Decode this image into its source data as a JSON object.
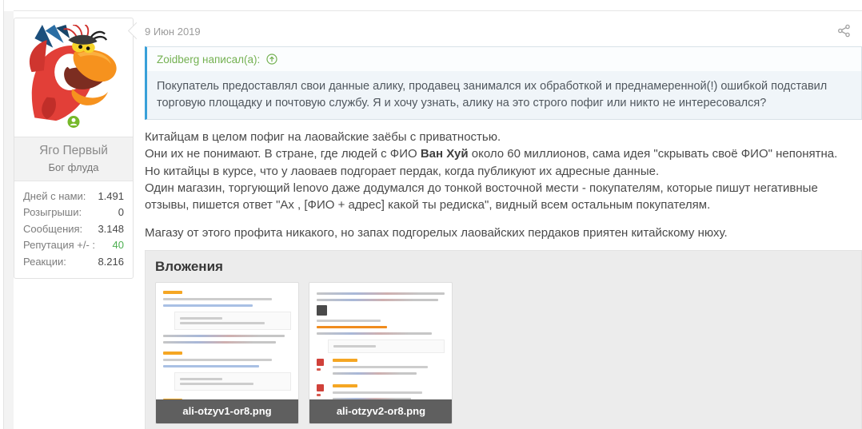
{
  "post": {
    "date": "9 Июн 2019"
  },
  "user": {
    "name": "Яго Первый",
    "title": "Бог флуда",
    "online": true,
    "stats": [
      {
        "label": "Дней с нами:",
        "value": "1.491"
      },
      {
        "label": "Розыгрыши:",
        "value": "0"
      },
      {
        "label": "Сообщения:",
        "value": "3.148"
      },
      {
        "label": "Репутация +/- :",
        "value": "40"
      },
      {
        "label": "Реакции:",
        "value": "8.216"
      }
    ]
  },
  "quote": {
    "attribution": "Zoidberg написал(а):",
    "text": "Покупатель предоставлял свои данные алику, продавец занимался их обработкой и преднамеренной(!) ошибкой подставил торговую площадку и почтовую службу. Я и хочу узнать, алику на это строго пофиг или никто не интересовался?"
  },
  "body": {
    "line1": "Китайцам в целом пофиг на лаовайские заёбы с приватностью.",
    "line2_pre": "Они их не понимают. В стране, где людей с ФИО ",
    "line2_bold": "Ван Хуй",
    "line2_post": " около 60 миллионов, сама идея \"скрывать своё ФИО\" непонятна.",
    "line3": "Но китайцы в курсе, что у лаоваев подгорает пердак, когда публикуют их адресные данные.",
    "line4": "Один магазин, торгующий lenovo даже додумался до тонкой восточной мести - покупателям, которые пишут негативные отзывы, пишется ответ \"Ах , [ФИО + адрес] какой ты редиска\", видный всем остальным покупателям.",
    "para2": "Магазу от этого профита никакого, но запах подгорелых лаовайских пердаков приятен китайскому нюху."
  },
  "attachments": {
    "heading": "Вложения",
    "files": [
      {
        "name": "ali-otzyv1-or8.png"
      },
      {
        "name": "ali-otzyv2-or8.png"
      }
    ]
  },
  "icons": {
    "share": "share-icon",
    "online": "online-indicator-icon",
    "quote_jump": "arrow-up-circle-icon"
  },
  "colors": {
    "accent_green": "#74b152",
    "quote_border_blue": "#38a0d9",
    "reputation_green": "#4caf50",
    "attachments_bg": "#ececec",
    "caption_bg": "#5f5f5f"
  }
}
